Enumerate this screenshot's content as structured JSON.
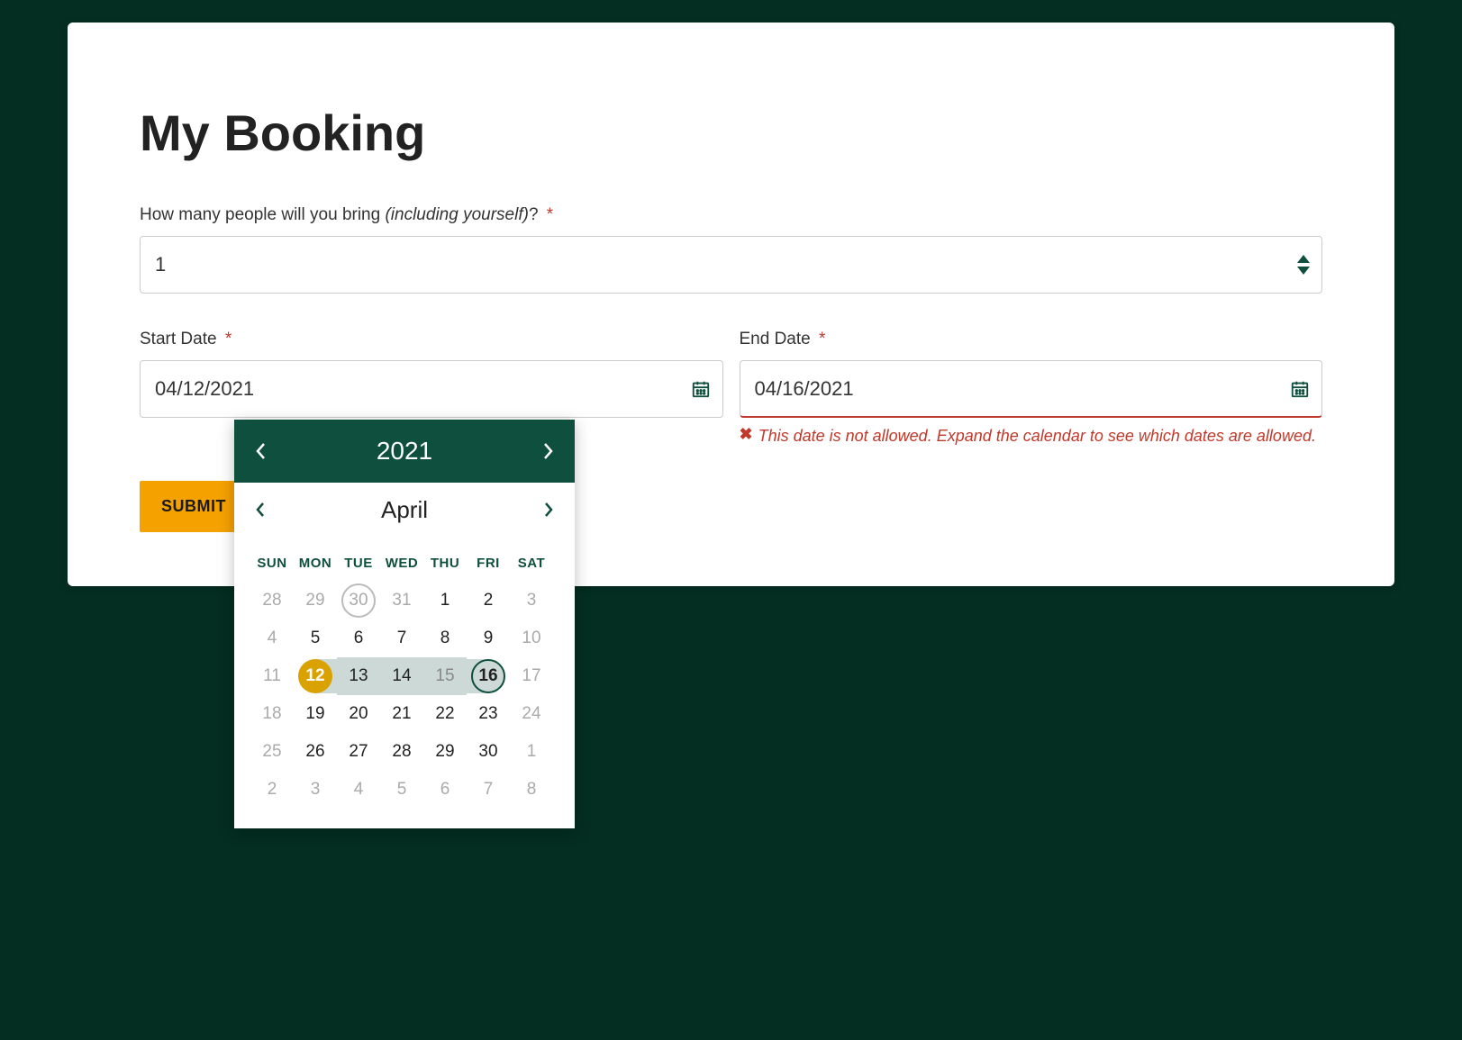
{
  "title": "My Booking",
  "people": {
    "label_before": "How many people will you bring ",
    "label_em": "(including yourself)",
    "label_after": "?",
    "value": "1"
  },
  "start_date": {
    "label": "Start Date",
    "value": "04/12/2021"
  },
  "end_date": {
    "label": "End Date",
    "value": "04/16/2021",
    "error": "This date is not allowed. Expand the calendar to see which dates are allowed."
  },
  "submit_label": "SUBMIT",
  "datepicker": {
    "year": "2021",
    "month": "April",
    "dow": [
      "SUN",
      "MON",
      "TUE",
      "WED",
      "THU",
      "FRI",
      "SAT"
    ],
    "weeks": [
      [
        {
          "d": "28",
          "other": true
        },
        {
          "d": "29",
          "other": true
        },
        {
          "d": "30",
          "other": true,
          "today": true
        },
        {
          "d": "31",
          "other": true
        },
        {
          "d": "1"
        },
        {
          "d": "2"
        },
        {
          "d": "3",
          "muted": true
        }
      ],
      [
        {
          "d": "4",
          "muted": true
        },
        {
          "d": "5"
        },
        {
          "d": "6"
        },
        {
          "d": "7"
        },
        {
          "d": "8"
        },
        {
          "d": "9"
        },
        {
          "d": "10",
          "muted": true
        }
      ],
      [
        {
          "d": "11",
          "muted": true
        },
        {
          "d": "12",
          "sel_start": true
        },
        {
          "d": "13",
          "in_range": true
        },
        {
          "d": "14",
          "in_range": true
        },
        {
          "d": "15",
          "in_range": true,
          "midmuted": true
        },
        {
          "d": "16",
          "sel_end": true
        },
        {
          "d": "17",
          "muted": true
        }
      ],
      [
        {
          "d": "18",
          "muted": true
        },
        {
          "d": "19"
        },
        {
          "d": "20"
        },
        {
          "d": "21"
        },
        {
          "d": "22"
        },
        {
          "d": "23"
        },
        {
          "d": "24",
          "muted": true
        }
      ],
      [
        {
          "d": "25",
          "muted": true
        },
        {
          "d": "26"
        },
        {
          "d": "27"
        },
        {
          "d": "28"
        },
        {
          "d": "29"
        },
        {
          "d": "30"
        },
        {
          "d": "1",
          "other": true
        }
      ],
      [
        {
          "d": "2",
          "other": true
        },
        {
          "d": "3",
          "other": true
        },
        {
          "d": "4",
          "other": true
        },
        {
          "d": "5",
          "other": true
        },
        {
          "d": "6",
          "other": true
        },
        {
          "d": "7",
          "other": true
        },
        {
          "d": "8",
          "other": true
        }
      ]
    ]
  }
}
